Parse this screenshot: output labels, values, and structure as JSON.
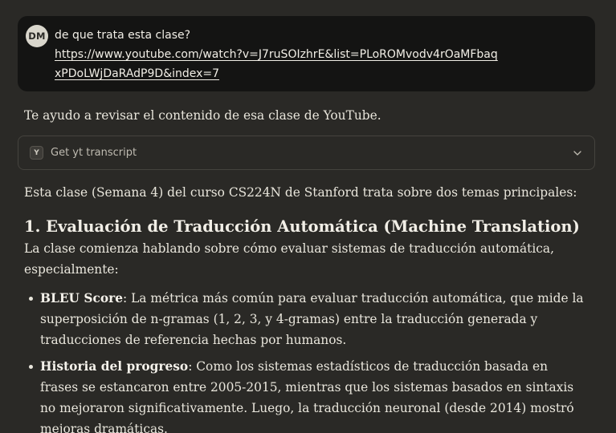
{
  "user_message": {
    "avatar_initials": "DM",
    "text": "de que trata esta clase?",
    "link": "https://www.youtube.com/watch?v=J7ruSOIzhrE&list=PLoROMvodv4rOaMFbaqxPDoLWjDaRAdP9D&index=7"
  },
  "assistant": {
    "intro": "Te ayudo a revisar el contenido de esa clase de YouTube.",
    "tool": {
      "icon_letter": "Y",
      "label": "Get yt transcript",
      "expand_icon": "chevron-down-icon"
    },
    "summary": "Esta clase (Semana 4) del curso CS224N de Stanford trata sobre dos temas principales:",
    "section1": {
      "heading": "1. Evaluación de Traducción Automática (Machine Translation)",
      "paragraph": "La clase comienza hablando sobre cómo evaluar sistemas de traducción automática, especialmente:",
      "bullets": [
        {
          "term": "BLEU Score",
          "text": ": La métrica más común para evaluar traducción automática, que mide la superposición de n-gramas (1, 2, 3, y 4-gramas) entre la traducción generada y traducciones de referencia hechas por humanos."
        },
        {
          "term": "Historia del progreso",
          "text": ": Como los sistemas estadísticos de traducción basada en frases se estancaron entre 2005-2015, mientras que los sistemas basados en sintaxis no mejoraron significativamente. Luego, la traducción neuronal (desde 2014) mostró mejoras dramáticas."
        }
      ]
    }
  },
  "colors": {
    "background": "#2a2926",
    "user_bubble": "#141413",
    "text": "#e9e6dc",
    "border": "#45433e"
  }
}
